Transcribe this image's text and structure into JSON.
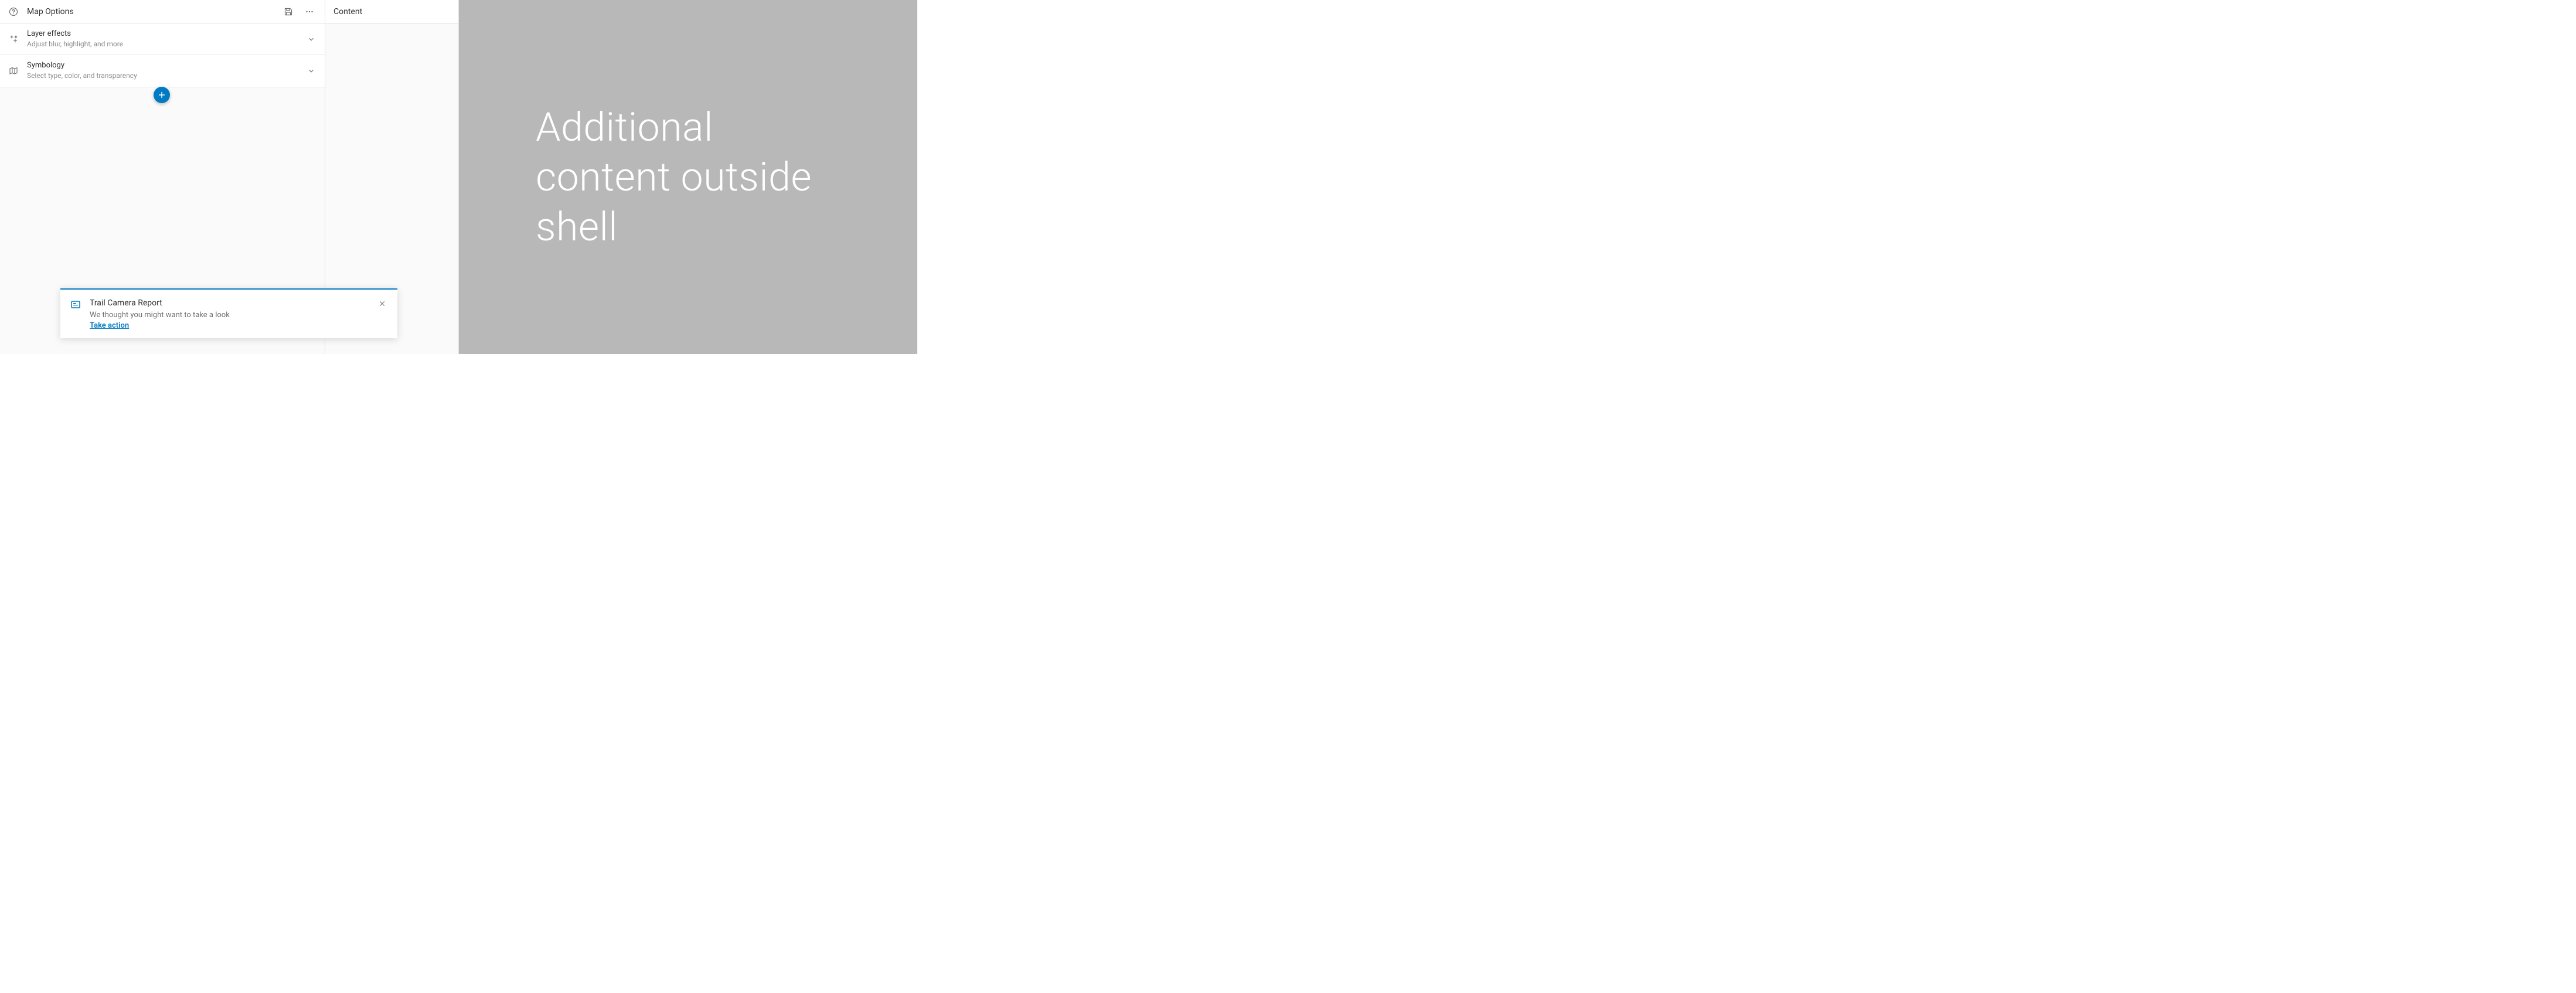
{
  "panel": {
    "title": "Map Options"
  },
  "options": [
    {
      "title": "Layer effects",
      "subtitle": "Adjust blur, highlight, and more"
    },
    {
      "title": "Symbology",
      "subtitle": "Select type, color, and transparency"
    }
  ],
  "notice": {
    "title": "Trail Camera Report",
    "message": "We thought you might want to take a look",
    "action": "Take action"
  },
  "content": {
    "title": "Content"
  },
  "outside": {
    "text": "Additional content outside shell"
  },
  "colors": {
    "accent": "#007ac2"
  }
}
